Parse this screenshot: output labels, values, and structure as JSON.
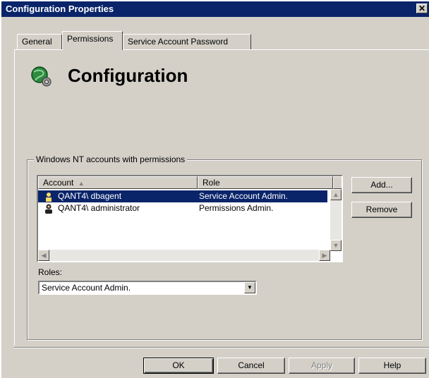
{
  "window": {
    "title": "Configuration Properties",
    "close_glyph": "✕"
  },
  "tabs": [
    {
      "label": "General"
    },
    {
      "label": "Permissions"
    },
    {
      "label": "Service Account Password"
    }
  ],
  "header": {
    "title": "Configuration",
    "icon": "configuration-icon"
  },
  "group": {
    "label": "Windows NT accounts with permissions"
  },
  "table": {
    "columns": [
      {
        "label": "Account",
        "sort": "ascending"
      },
      {
        "label": "Role"
      }
    ],
    "rows": [
      {
        "account": "QANT4\\ dbagent",
        "role": "Service Account Admin.",
        "selected": true,
        "icon": "user-icon"
      },
      {
        "account": "QANT4\\ administrator",
        "role": "Permissions Admin.",
        "selected": false,
        "icon": "admin-user-icon"
      }
    ]
  },
  "side_buttons": {
    "add": "Add...",
    "remove": "Remove"
  },
  "roles": {
    "label": "Roles:",
    "selected": "Service Account Admin."
  },
  "footer": {
    "ok": "OK",
    "cancel": "Cancel",
    "apply": "Apply",
    "help": "Help"
  },
  "colors": {
    "face": "#d4d0c8",
    "selection": "#0a246a",
    "title_bar": "#0a246a"
  }
}
